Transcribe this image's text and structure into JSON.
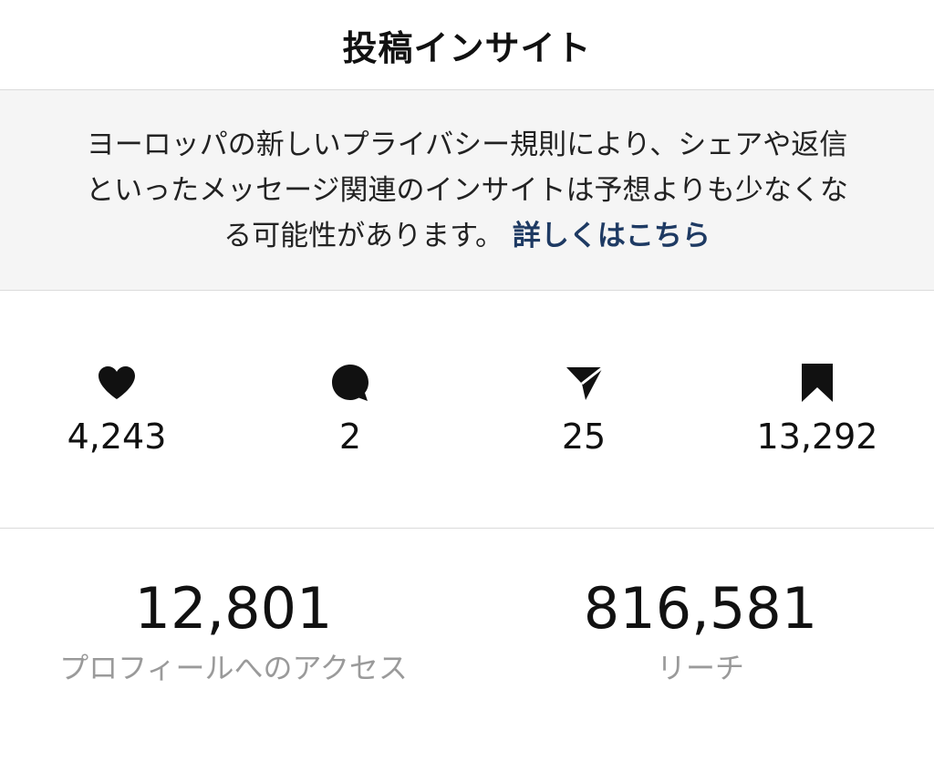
{
  "header": {
    "title": "投稿インサイト"
  },
  "notice": {
    "text": "ヨーロッパの新しいプライバシー規則により、シェアや返信といったメッセージ関連のインサイトは予想よりも少なくなる可能性があります。",
    "link_label": "詳しくはこちら"
  },
  "stats": [
    {
      "icon": "heart-icon",
      "value": "4,243"
    },
    {
      "icon": "comment-icon",
      "value": "2"
    },
    {
      "icon": "send-icon",
      "value": "25"
    },
    {
      "icon": "bookmark-icon",
      "value": "13,292"
    }
  ],
  "metrics": [
    {
      "value": "12,801",
      "label": "プロフィールへのアクセス"
    },
    {
      "value": "816,581",
      "label": "リーチ"
    }
  ],
  "colors": {
    "link": "#1e3a63",
    "notice_bg": "#f5f5f5",
    "muted_label": "#9a9a9a",
    "divider": "#dbdbdb"
  }
}
